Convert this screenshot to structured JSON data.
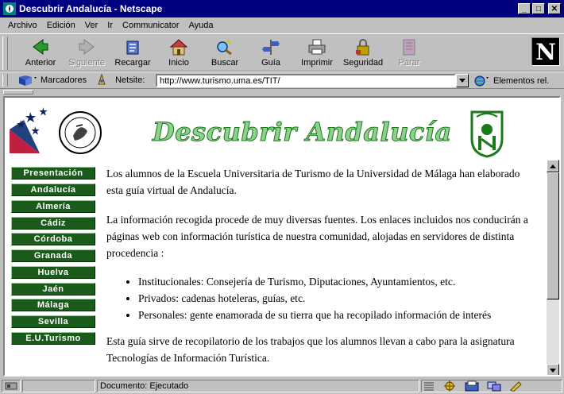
{
  "window": {
    "title": "Descubrir Andalucía - Netscape"
  },
  "menu": [
    "Archivo",
    "Edición",
    "Ver",
    "Ir",
    "Communicator",
    "Ayuda"
  ],
  "toolbar": [
    {
      "label": "Anterior",
      "icon": "back-icon",
      "enabled": true
    },
    {
      "label": "Siguiente",
      "icon": "forward-icon",
      "enabled": false
    },
    {
      "label": "Recargar",
      "icon": "reload-icon",
      "enabled": true
    },
    {
      "label": "Inicio",
      "icon": "home-icon",
      "enabled": true
    },
    {
      "label": "Buscar",
      "icon": "search-icon",
      "enabled": true
    },
    {
      "label": "Guía",
      "icon": "guide-icon",
      "enabled": true
    },
    {
      "label": "Imprimir",
      "icon": "print-icon",
      "enabled": true
    },
    {
      "label": "Seguridad",
      "icon": "lock-icon",
      "enabled": true
    },
    {
      "label": "Parar",
      "icon": "stop-icon",
      "enabled": false
    }
  ],
  "location": {
    "bookmarks_label": "Marcadores",
    "netsite_label": "Netsite:",
    "url": "http://www.turismo.uma.es/TIT/",
    "related_label": "Elementos rel."
  },
  "page": {
    "banner": "Descubrir Andalucía",
    "nav": [
      "Presentación",
      "Andalucía",
      "Almería",
      "Cádiz",
      "Córdoba",
      "Granada",
      "Huelva",
      "Jaén",
      "Málaga",
      "Sevilla",
      "E.U.Turismo"
    ],
    "p1": "Los alumnos de la Escuela Universitaria de Turismo de la Universidad de Málaga han elaborado esta guía virtual de Andalucía.",
    "p2": "La información recogida procede de muy diversas fuentes. Los enlaces incluidos nos conducirán a páginas web con información turística de nuestra comunidad, alojadas en servidores de distinta procedencia :",
    "bullets": [
      "Institucionales: Consejería de Turismo, Diputaciones, Ayuntamientos, etc.",
      "Privados: cadenas hoteleras, guías, etc.",
      "Personales: gente enamorada de su tierra que ha recopilado información de interés"
    ],
    "p3": "Esta guía sirve de recopilatorio de los trabajos que los alumnos llevan a cabo para la asignatura Tecnologías de Información Turística."
  },
  "status": {
    "text": "Documento: Ejecutado"
  },
  "colors": {
    "titlebar": "#000080",
    "nav_button": "#1a5a1a",
    "banner_green": "#8ed08e"
  }
}
